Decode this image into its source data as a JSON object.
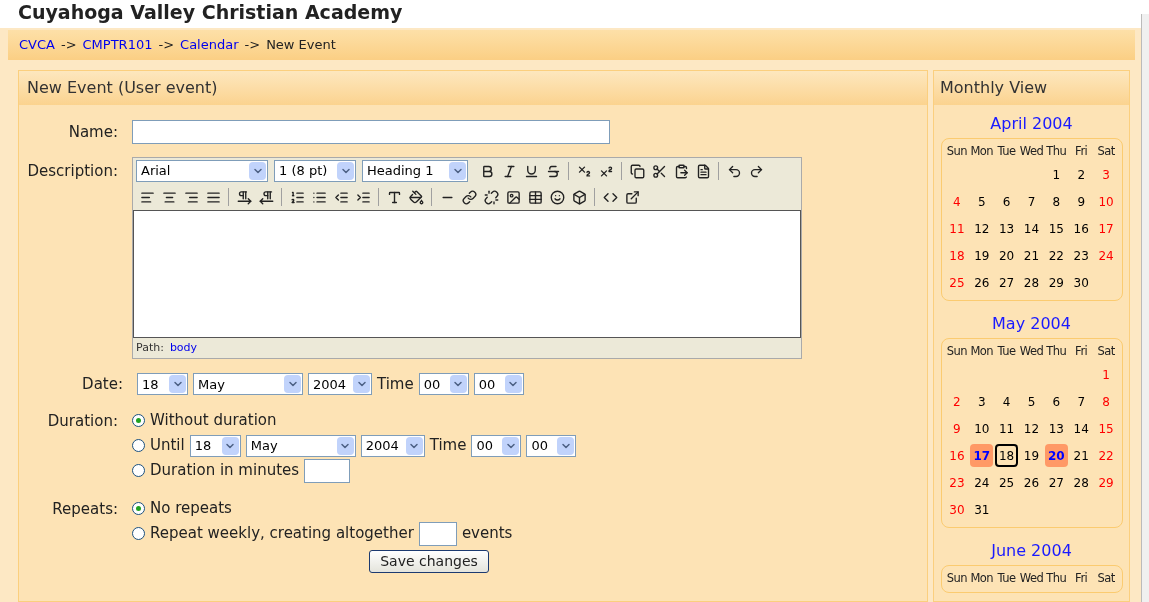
{
  "site_title": "Cuyahoga Valley Christian Academy",
  "breadcrumb": [
    {
      "text": "CVCA",
      "link": true
    },
    {
      "text": "->",
      "link": false
    },
    {
      "text": "CMPTR101",
      "link": true
    },
    {
      "text": "->",
      "link": false
    },
    {
      "text": "Calendar",
      "link": true
    },
    {
      "text": "->",
      "link": false
    },
    {
      "text": "New Event",
      "link": false
    }
  ],
  "form": {
    "title": "New Event (User event)",
    "name": {
      "label": "Name:"
    },
    "description": {
      "label": "Description:",
      "font": "Arial",
      "size": "1 (8 pt)",
      "format": "Heading 1",
      "path_label": "Path:",
      "path_value": "body"
    },
    "date": {
      "label": "Date:",
      "day": "18",
      "month": "May",
      "year": "2004",
      "time_label": "Time",
      "hour": "00",
      "minute": "00"
    },
    "duration": {
      "label": "Duration:",
      "options": [
        {
          "kind": "plain",
          "text": "Without duration",
          "selected": true
        },
        {
          "kind": "until",
          "text": "Until",
          "day": "18",
          "month": "May",
          "year": "2004",
          "time_label": "Time",
          "hour": "00",
          "minute": "00",
          "selected": false
        },
        {
          "kind": "minutes",
          "text": "Duration in minutes",
          "selected": false
        }
      ]
    },
    "repeats": {
      "label": "Repeats:",
      "options": [
        {
          "kind": "plain",
          "text": "No repeats",
          "selected": true
        },
        {
          "kind": "count",
          "text": "Repeat weekly, creating altogether",
          "suffix": "events",
          "selected": false
        }
      ]
    },
    "save": "Save changes"
  },
  "sidebar": {
    "title": "Monthly View",
    "months": [
      {
        "name": "April 2004",
        "weekdays": [
          "Sun",
          "Mon",
          "Tue",
          "Wed",
          "Thu",
          "Fri",
          "Sat"
        ],
        "weeks": [
          [
            {
              "d": "1",
              "kind": "weekday"
            },
            {
              "d": "2",
              "kind": "weekday"
            },
            {
              "d": "3",
              "kind": "weekend"
            }
          ],
          [
            {
              "d": "4",
              "kind": "weekend"
            },
            {
              "d": "5",
              "kind": "weekday"
            },
            {
              "d": "6",
              "kind": "weekday"
            },
            {
              "d": "7",
              "kind": "weekday"
            },
            {
              "d": "8",
              "kind": "weekday"
            },
            {
              "d": "9",
              "kind": "weekday"
            },
            {
              "d": "10",
              "kind": "weekend"
            }
          ],
          [
            {
              "d": "11",
              "kind": "weekend"
            },
            {
              "d": "12",
              "kind": "weekday"
            },
            {
              "d": "13",
              "kind": "weekday"
            },
            {
              "d": "14",
              "kind": "weekday"
            },
            {
              "d": "15",
              "kind": "weekday"
            },
            {
              "d": "16",
              "kind": "weekday"
            },
            {
              "d": "17",
              "kind": "weekend"
            }
          ],
          [
            {
              "d": "18",
              "kind": "weekend"
            },
            {
              "d": "19",
              "kind": "weekday"
            },
            {
              "d": "20",
              "kind": "weekday"
            },
            {
              "d": "21",
              "kind": "weekday"
            },
            {
              "d": "22",
              "kind": "weekday"
            },
            {
              "d": "23",
              "kind": "weekday"
            },
            {
              "d": "24",
              "kind": "weekend"
            }
          ],
          [
            {
              "d": "25",
              "kind": "weekend"
            },
            {
              "d": "26",
              "kind": "weekday"
            },
            {
              "d": "27",
              "kind": "weekday"
            },
            {
              "d": "28",
              "kind": "weekday"
            },
            {
              "d": "29",
              "kind": "weekday"
            },
            {
              "d": "30",
              "kind": "weekday"
            }
          ]
        ]
      },
      {
        "name": "May 2004",
        "weekdays": [
          "Sun",
          "Mon",
          "Tue",
          "Wed",
          "Thu",
          "Fri",
          "Sat"
        ],
        "weeks": [
          [
            {
              "d": "1",
              "kind": "weekend"
            }
          ],
          [
            {
              "d": "2",
              "kind": "weekend"
            },
            {
              "d": "3",
              "kind": "weekday"
            },
            {
              "d": "4",
              "kind": "weekday"
            },
            {
              "d": "5",
              "kind": "weekday"
            },
            {
              "d": "6",
              "kind": "weekday"
            },
            {
              "d": "7",
              "kind": "weekday"
            },
            {
              "d": "8",
              "kind": "weekend"
            }
          ],
          [
            {
              "d": "9",
              "kind": "weekend"
            },
            {
              "d": "10",
              "kind": "weekday"
            },
            {
              "d": "11",
              "kind": "weekday"
            },
            {
              "d": "12",
              "kind": "weekday"
            },
            {
              "d": "13",
              "kind": "weekday"
            },
            {
              "d": "14",
              "kind": "weekday"
            },
            {
              "d": "15",
              "kind": "weekend"
            }
          ],
          [
            {
              "d": "16",
              "kind": "weekend"
            },
            {
              "d": "17",
              "kind": "event"
            },
            {
              "d": "18",
              "kind": "today"
            },
            {
              "d": "19",
              "kind": "weekday"
            },
            {
              "d": "20",
              "kind": "event"
            },
            {
              "d": "21",
              "kind": "weekday"
            },
            {
              "d": "22",
              "kind": "weekend"
            }
          ],
          [
            {
              "d": "23",
              "kind": "weekend"
            },
            {
              "d": "24",
              "kind": "weekday"
            },
            {
              "d": "25",
              "kind": "weekday"
            },
            {
              "d": "26",
              "kind": "weekday"
            },
            {
              "d": "27",
              "kind": "weekday"
            },
            {
              "d": "28",
              "kind": "weekday"
            },
            {
              "d": "29",
              "kind": "weekend"
            }
          ],
          [
            {
              "d": "30",
              "kind": "weekend"
            },
            {
              "d": "31",
              "kind": "weekday"
            }
          ]
        ]
      },
      {
        "name": "June 2004",
        "weekdays": [
          "Sun",
          "Mon",
          "Tue",
          "Wed",
          "Thu",
          "Fri",
          "Sat"
        ]
      }
    ]
  }
}
